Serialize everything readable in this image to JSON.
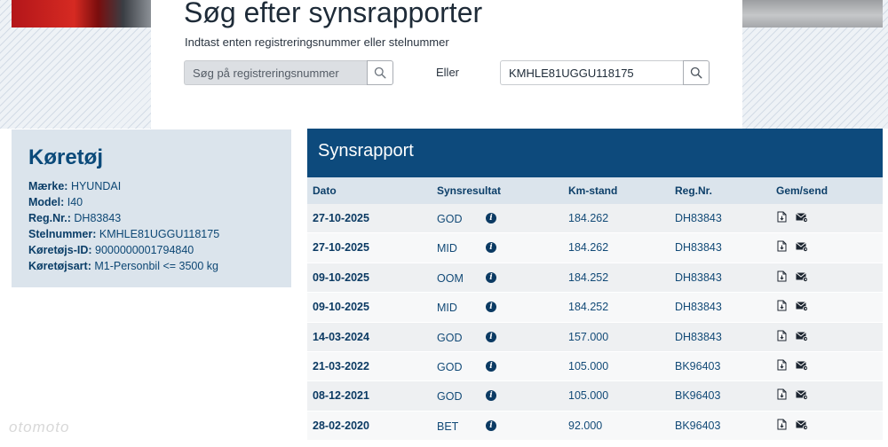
{
  "search": {
    "title": "Søg efter synsrapporter",
    "subtitle": "Indtast enten registreringsnummer eller stelnummer",
    "reg_placeholder": "Søg på registreringsnummer",
    "or_label": "Eller",
    "vin_value": "KMHLE81UGGU118175"
  },
  "vehicle": {
    "title": "Køretøj",
    "fields": [
      {
        "label": "Mærke",
        "value": "HYUNDAI"
      },
      {
        "label": "Model",
        "value": "I40"
      },
      {
        "label": "Reg.Nr.",
        "value": "DH83843"
      },
      {
        "label": "Stelnummer",
        "value": "KMHLE81UGGU118175"
      },
      {
        "label": "Køretøjs-ID",
        "value": "9000000001794840"
      },
      {
        "label": "Køretøjsart",
        "value": "M1-Personbil <= 3500 kg"
      }
    ]
  },
  "report": {
    "title": "Synsrapport",
    "columns": [
      "Dato",
      "Synsresultat",
      "Km-stand",
      "Reg.Nr.",
      "Gem/send"
    ],
    "rows": [
      {
        "date": "27-10-2025",
        "result": "GOD",
        "km": "184.262",
        "reg": "DH83843"
      },
      {
        "date": "27-10-2025",
        "result": "MID",
        "km": "184.262",
        "reg": "DH83843"
      },
      {
        "date": "09-10-2025",
        "result": "OOM",
        "km": "184.252",
        "reg": "DH83843"
      },
      {
        "date": "09-10-2025",
        "result": "MID",
        "km": "184.252",
        "reg": "DH83843"
      },
      {
        "date": "14-03-2024",
        "result": "GOD",
        "km": "157.000",
        "reg": "DH83843"
      },
      {
        "date": "21-03-2022",
        "result": "GOD",
        "km": "105.000",
        "reg": "BK96403"
      },
      {
        "date": "08-12-2021",
        "result": "GOD",
        "km": "105.000",
        "reg": "BK96403"
      },
      {
        "date": "28-02-2020",
        "result": "BET",
        "km": "92.000",
        "reg": "BK96403"
      }
    ]
  },
  "watermark": "otomoto",
  "colors": {
    "header_blue": "#0d4a7c",
    "panel_bg": "#dbe4ec",
    "text_blue": "#124a77"
  },
  "icons": [
    "search-icon",
    "info-icon",
    "pdf-download-icon",
    "send-mail-icon"
  ]
}
